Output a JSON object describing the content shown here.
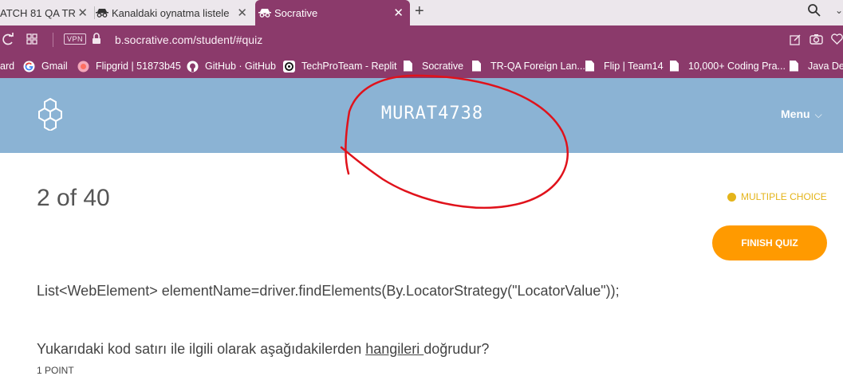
{
  "browser": {
    "tabs": [
      {
        "title": "ATCH 81 QA TR"
      },
      {
        "title": "Kanaldaki oynatma listeleri"
      },
      {
        "title": "Socrative"
      }
    ],
    "address": {
      "vpn_label": "VPN",
      "url": "b.socrative.com/student/#quiz"
    },
    "bookmarks": [
      {
        "label": "ard"
      },
      {
        "label": "Gmail"
      },
      {
        "label": "Flipgrid | 51873b45"
      },
      {
        "label": "GitHub · GitHub"
      },
      {
        "label": "TechProTeam - Replit"
      },
      {
        "label": "Socrative"
      },
      {
        "label": "TR-QA Foreign Lan..."
      },
      {
        "label": "Flip | Team14"
      },
      {
        "label": "10,000+ Coding Pra..."
      },
      {
        "label": "Java Dev"
      }
    ]
  },
  "header": {
    "room_name": "MURAT4738",
    "menu_label": "Menu"
  },
  "quiz": {
    "progress": "2 of 40",
    "question_type": "MULTIPLE CHOICE",
    "finish_label": "FINISH QUIZ",
    "code_line": "List<WebElement> elementName=driver.findElements(By.LocatorStrategy(\"LocatorValue\"));",
    "question_before": "Yukarıdaki kod satırı ile ilgili olarak aşağıdakilerden ",
    "question_underlined": "hangileri ",
    "question_after": "doğrudur?",
    "points": "1 POINT"
  },
  "colors": {
    "accent": "#8b3a6b",
    "header_bg": "#8bb3d4",
    "finish_button": "#ff9a00",
    "question_type": "#e4b41a",
    "annotation": "#e0121b"
  }
}
